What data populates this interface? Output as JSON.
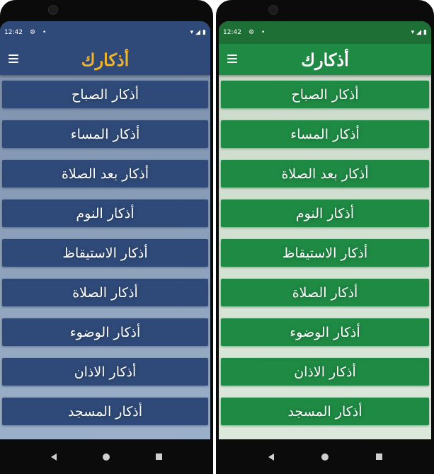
{
  "status_bar": {
    "time": "12:42",
    "icons": [
      "settings-gear-icon",
      "dot-icon",
      "wifi-icon",
      "signal-icon",
      "battery-icon"
    ]
  },
  "app_bar": {
    "title": "أذكارك",
    "menu_icon": "hamburger-menu-icon"
  },
  "items": [
    {
      "label": "أذكار الصباح"
    },
    {
      "label": "أذكار المساء"
    },
    {
      "label": "أذكار بعد الصلاة"
    },
    {
      "label": "أذكار النوم"
    },
    {
      "label": "أذكار الاستيقاظ"
    },
    {
      "label": "أذكار الصلاة"
    },
    {
      "label": "أذكار الوضوء"
    },
    {
      "label": "أذكار الاذان"
    },
    {
      "label": "أذكار المسجد"
    }
  ],
  "themes": {
    "blue": {
      "primary": "#2f4a78",
      "title_color": "#f0b52a"
    },
    "green": {
      "primary": "#1f8a44",
      "title_color": "#ffffff"
    }
  },
  "nav_bar": {
    "icons": [
      "back-icon",
      "home-icon",
      "recents-icon"
    ]
  }
}
